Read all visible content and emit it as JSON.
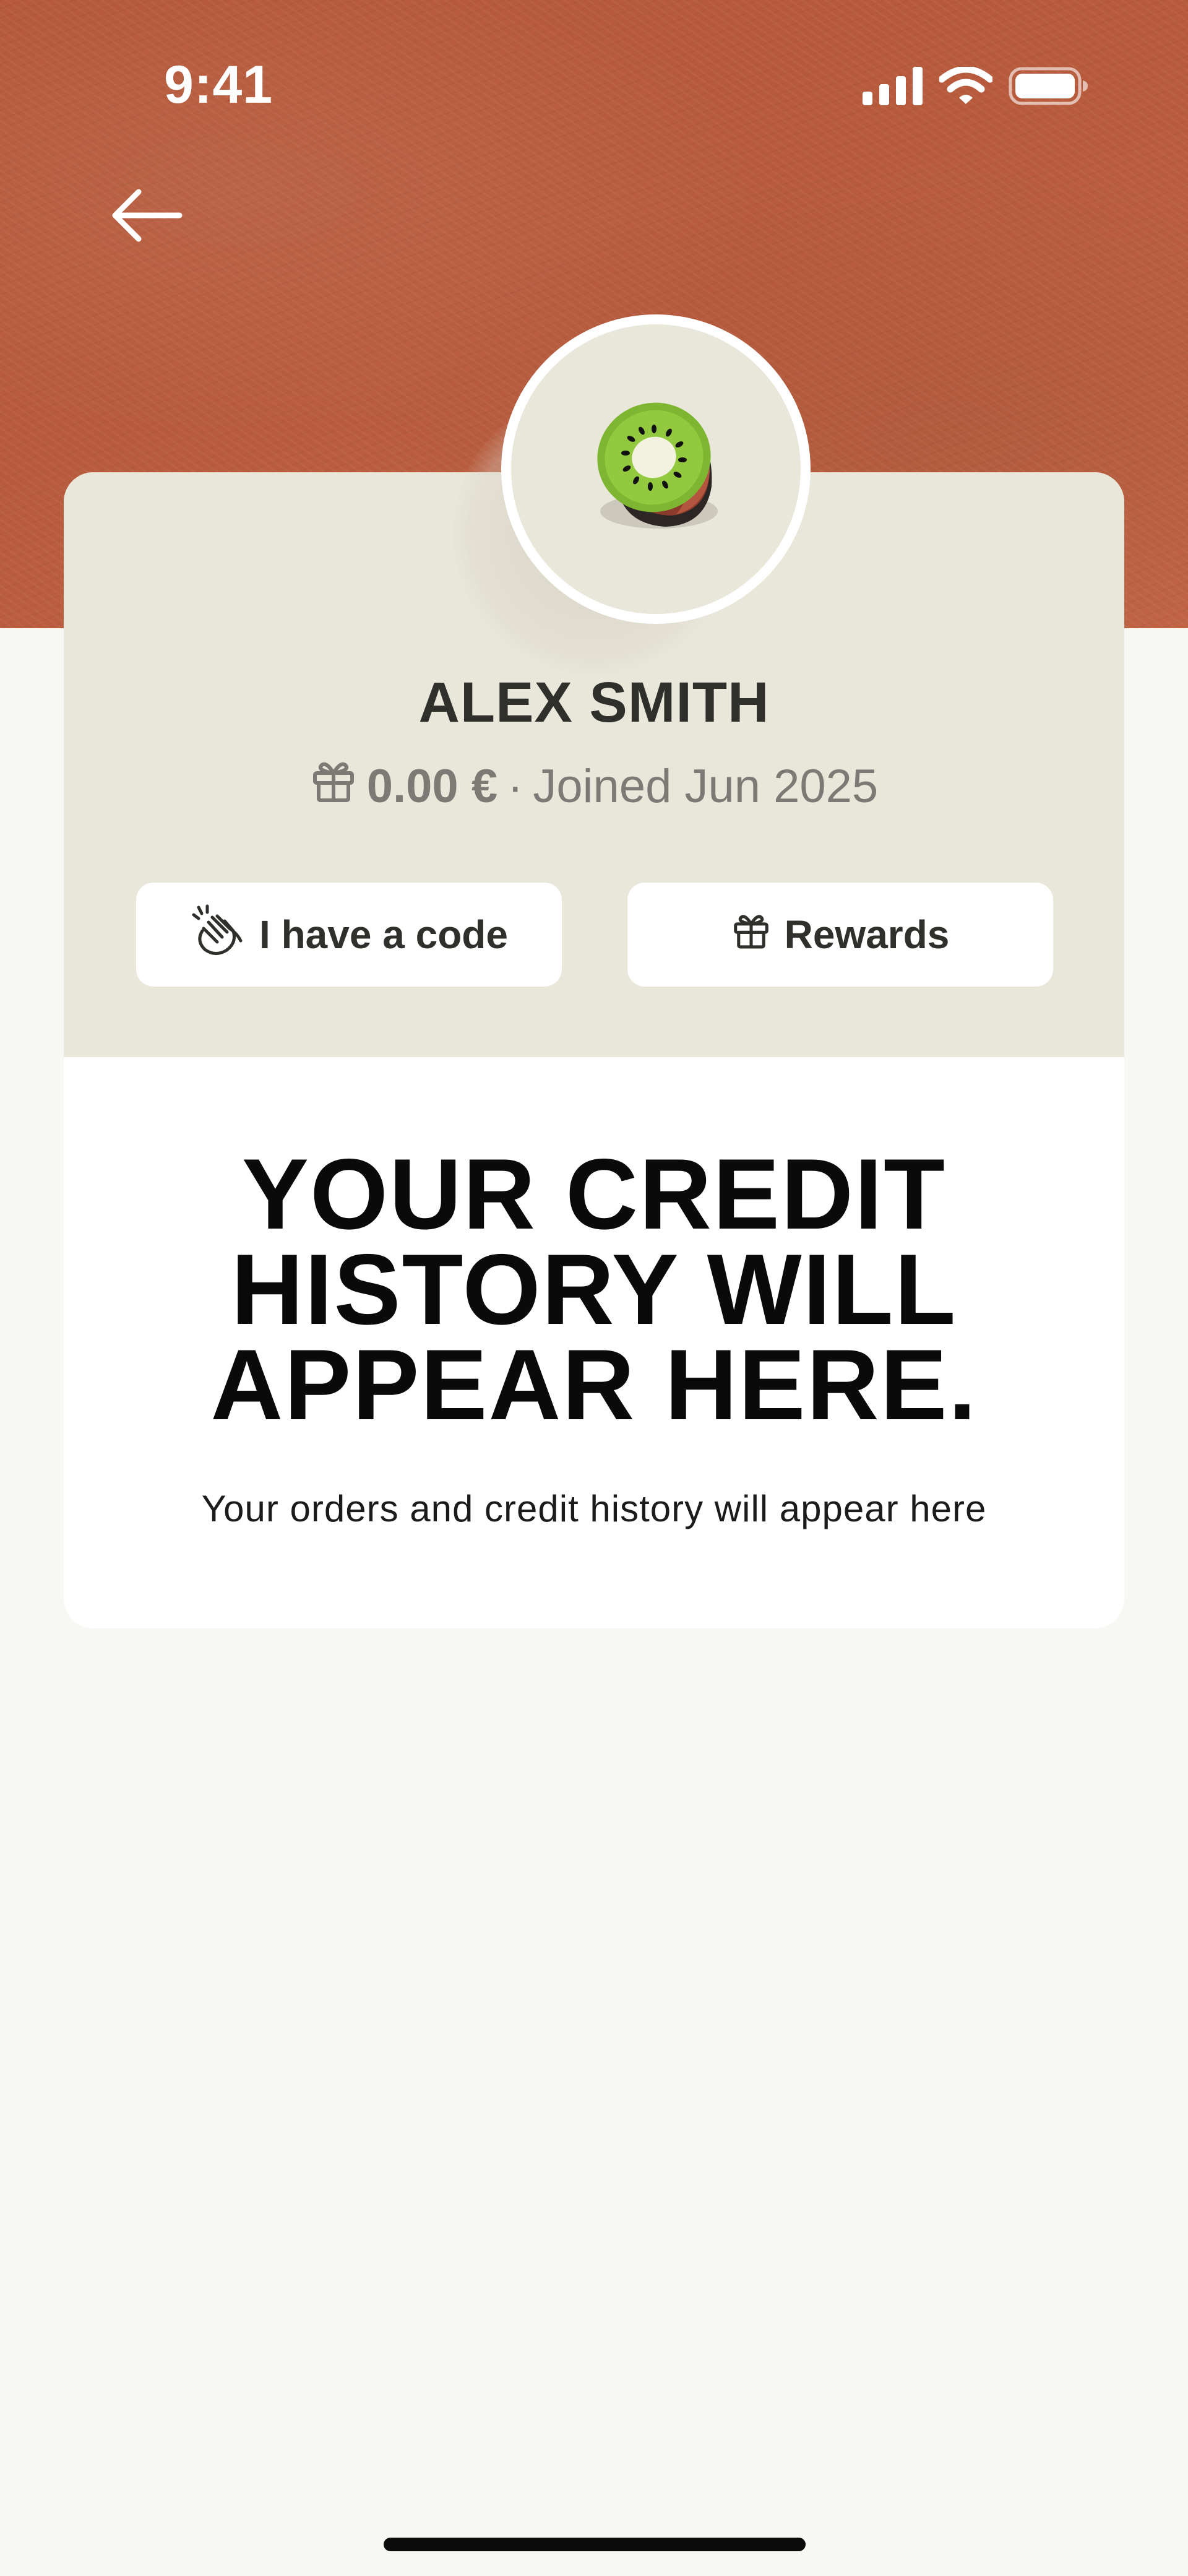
{
  "status_bar": {
    "time": "9:41",
    "icons": [
      "cellular-signal-icon",
      "wifi-icon",
      "battery-icon"
    ]
  },
  "header": {
    "back_icon": "arrow-left-icon"
  },
  "profile": {
    "avatar_icon": "kiwi-icon",
    "name": "ALEX SMITH",
    "credit_icon": "gift-icon",
    "credit": "0.00 €",
    "separator": "·",
    "joined": "Joined Jun 2025"
  },
  "actions": {
    "code_icon": "clapping-hands-icon",
    "code_label": "I have a code",
    "rewards_icon": "gift-icon",
    "rewards_label": "Rewards"
  },
  "empty_state": {
    "title_lines": [
      "YOUR CREDIT",
      "HISTORY WILL",
      "APPEAR HERE."
    ],
    "subtitle": "Your orders and credit history will appear here"
  },
  "colors": {
    "hero_background": "#b85b3d",
    "card_top": "#e9e6da",
    "page_background": "#f7f7f3",
    "kiwi_flesh": "#8fc13c",
    "kiwi_skin": "#7a3a28"
  }
}
